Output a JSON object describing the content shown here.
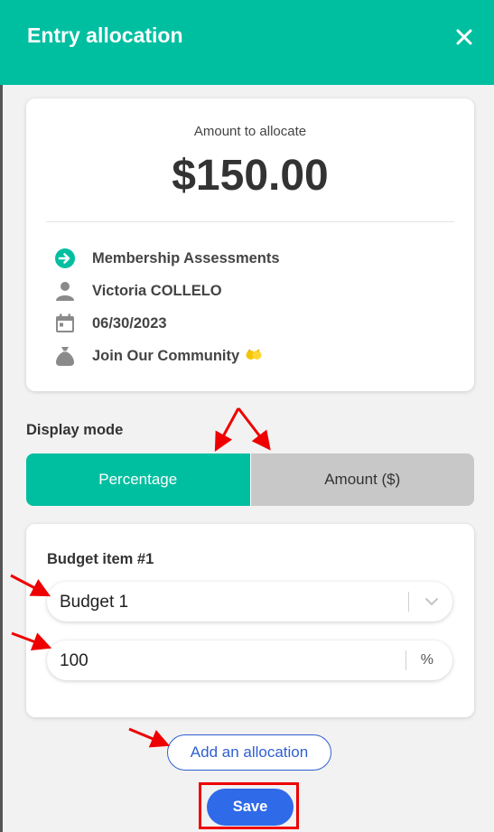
{
  "header": {
    "title": "Entry allocation",
    "close_icon": "close-icon"
  },
  "summary": {
    "amount_label": "Amount to allocate",
    "amount_value": "$150.00",
    "rows": [
      {
        "icon": "arrow-right-circle-icon",
        "text": "Membership Assessments"
      },
      {
        "icon": "person-icon",
        "text": "Victoria COLLELO"
      },
      {
        "icon": "calendar-icon",
        "text": "06/30/2023"
      },
      {
        "icon": "money-bag-icon",
        "text": "Join Our Community"
      }
    ]
  },
  "display_mode": {
    "title": "Display mode",
    "options": [
      "Percentage",
      "Amount ($)"
    ],
    "selected": "Percentage"
  },
  "budget_item": {
    "title": "Budget item #1",
    "selected_budget": "Budget 1",
    "percentage": "100",
    "percent_suffix": "%"
  },
  "actions": {
    "add_allocation": "Add an allocation",
    "save": "Save"
  },
  "colors": {
    "accent": "#00bfa0",
    "primary_button": "#2f6ae8",
    "link": "#2f5fd1",
    "annotation": "#e00000"
  }
}
